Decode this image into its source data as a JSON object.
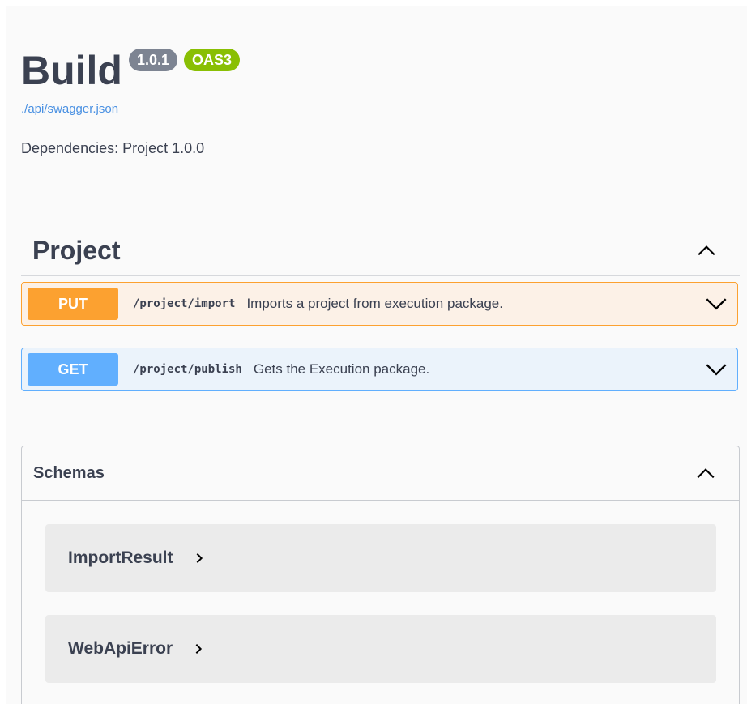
{
  "info": {
    "title": "Build",
    "version": "1.0.1",
    "oas_badge": "OAS3",
    "spec_link": "./api/swagger.json",
    "description": "Dependencies: Project 1.0.0"
  },
  "tag": {
    "name": "Project",
    "expanded_icon": "chevron-up-icon"
  },
  "operations": [
    {
      "method": "PUT",
      "path": "/project/import",
      "summary": "Imports a project from execution package.",
      "color": "#fca130"
    },
    {
      "method": "GET",
      "path": "/project/publish",
      "summary": "Gets the Execution package.",
      "color": "#61affe"
    }
  ],
  "schemas": {
    "title": "Schemas",
    "models": [
      {
        "name": "ImportResult"
      },
      {
        "name": "WebApiError"
      }
    ]
  },
  "colors": {
    "put": "#fca130",
    "get": "#61affe",
    "oas": "#89bf04",
    "version": "#7d8492",
    "link": "#4990e2"
  }
}
